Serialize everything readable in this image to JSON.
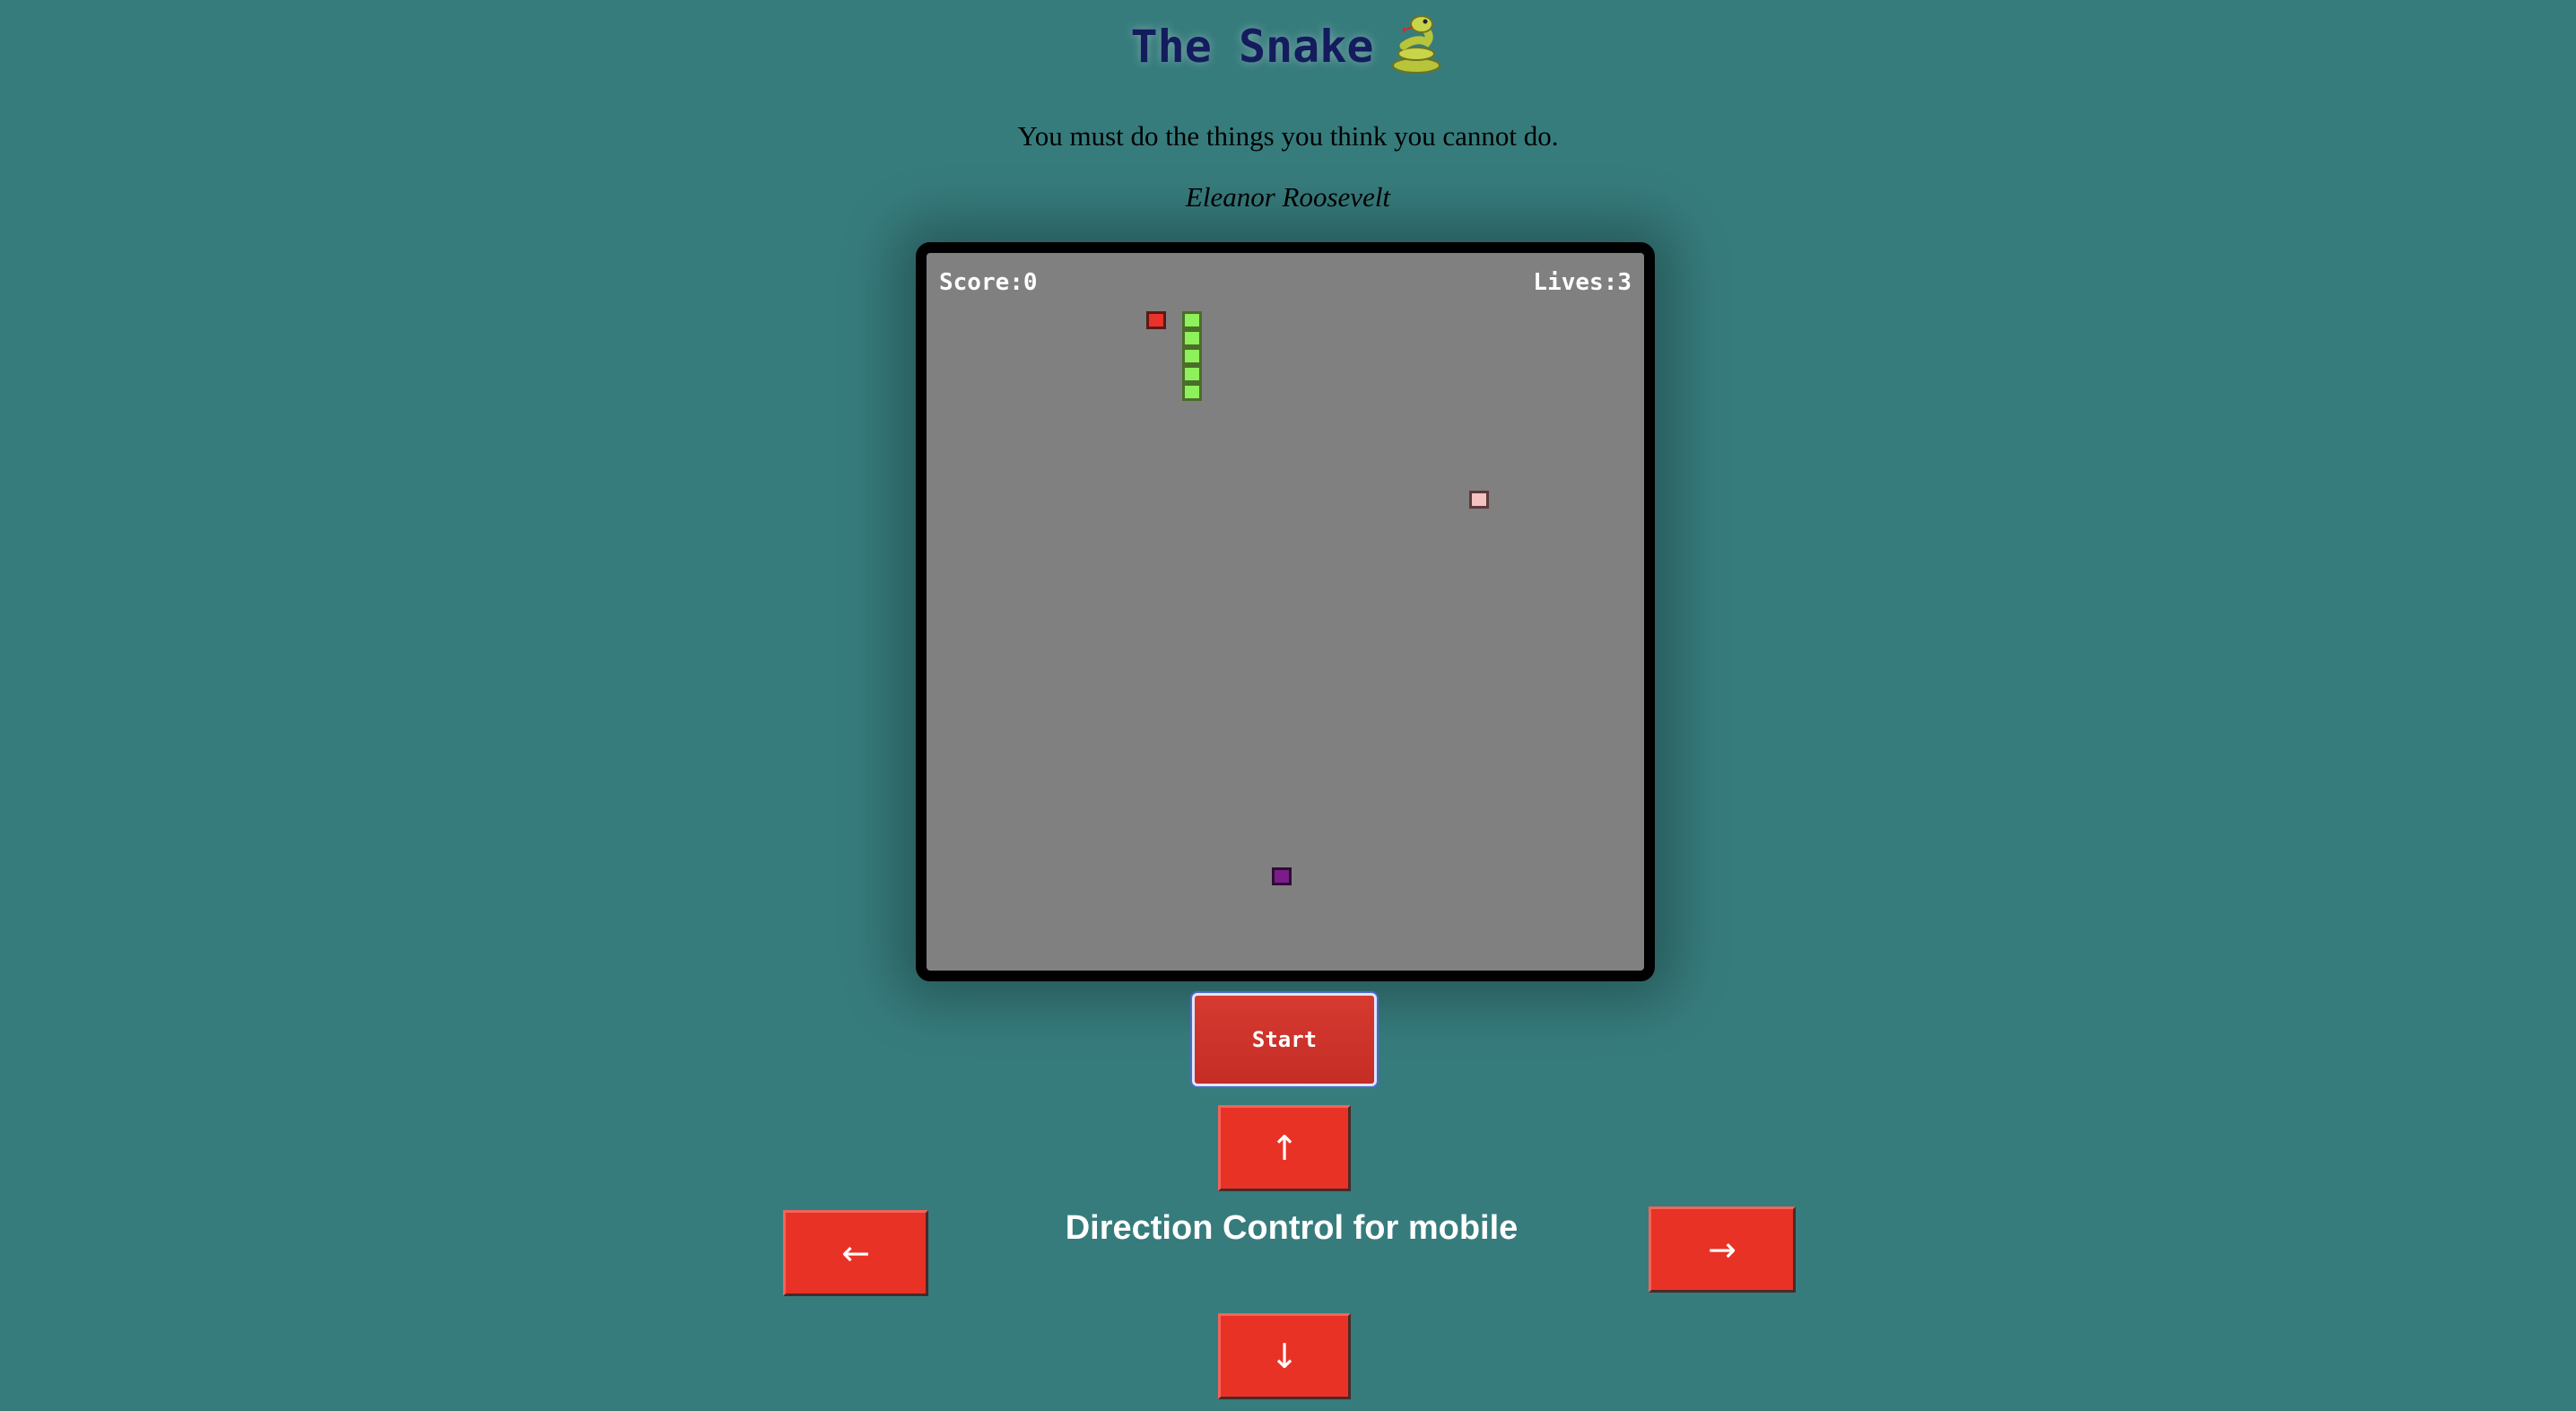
{
  "header": {
    "title": "The Snake",
    "title_icon": "snake-emoji-icon"
  },
  "quote": {
    "text": "You must do the things you think you cannot do.",
    "author": "Eleanor Roosevelt"
  },
  "game": {
    "score_label": "Score:0",
    "lives_label": "Lives:3",
    "board_color": "#808080",
    "snake_color": "#8ef05a",
    "items": [
      {
        "name": "food-red",
        "color": "#e8322a"
      },
      {
        "name": "food-pink",
        "color": "#f5c2c2"
      },
      {
        "name": "food-purple",
        "color": "#7a1d8a"
      }
    ]
  },
  "controls": {
    "start_label": "Start",
    "up_label": "↑",
    "down_label": "↓",
    "left_label": "←",
    "right_label": "→",
    "direction_caption": "Direction Control for mobile",
    "button_color": "#e83226"
  }
}
